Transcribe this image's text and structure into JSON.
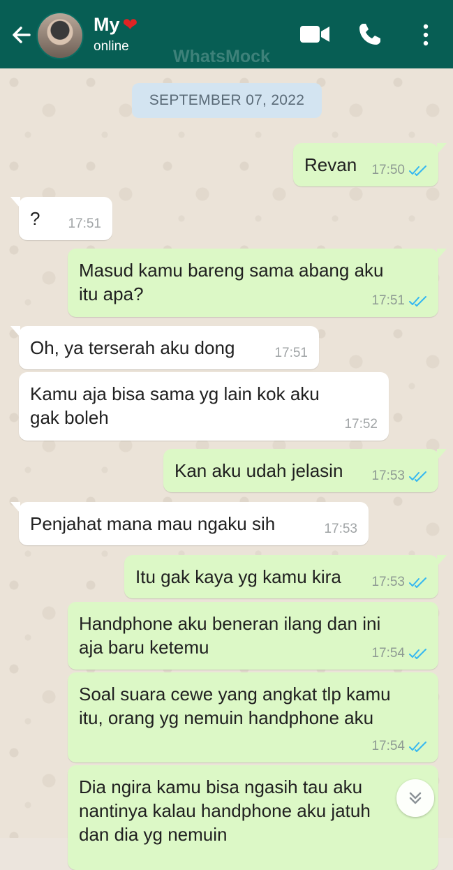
{
  "header": {
    "contact_name": "My",
    "heart_icon": "heart-icon",
    "status": "online",
    "watermark": "WhatsMock",
    "colors": {
      "bar": "#075e54",
      "outgoing": "#dcf8c6",
      "incoming": "#ffffff",
      "read_ticks": "#34b7f1"
    }
  },
  "date_chip": "SEPTEMBER 07, 2022",
  "messages": [
    {
      "dir": "out",
      "text": "Revan",
      "time": "17:50",
      "read": true
    },
    {
      "dir": "in",
      "text": "?",
      "time": "17:51"
    },
    {
      "dir": "out",
      "text": "Masud kamu bareng sama abang aku\nitu apa?",
      "time": "17:51",
      "read": true
    },
    {
      "dir": "in",
      "text": "Oh, ya terserah aku dong",
      "time": "17:51"
    },
    {
      "dir": "in",
      "text": "Kamu aja bisa sama yg lain kok aku\ngak boleh",
      "time": "17:52"
    },
    {
      "dir": "out",
      "text": "Kan aku udah jelasin",
      "time": "17:53",
      "read": true
    },
    {
      "dir": "in",
      "text": "Penjahat mana mau ngaku sih",
      "time": "17:53"
    },
    {
      "dir": "out",
      "text": "Itu gak kaya yg kamu kira",
      "time": "17:53",
      "read": true
    },
    {
      "dir": "out",
      "text": "Handphone aku beneran ilang dan ini\naja baru ketemu",
      "time": "17:54",
      "read": true
    },
    {
      "dir": "out",
      "text": "Soal suara cewe yang angkat tlp kamu\nitu, orang yg nemuin handphone aku",
      "time": "17:54",
      "read": true
    },
    {
      "dir": "out",
      "text": "Dia ngira kamu bisa ngasih tau aku\nnantinya kalau handphone aku jatuh\ndan dia yg nemuin",
      "time": "",
      "read": false
    }
  ]
}
